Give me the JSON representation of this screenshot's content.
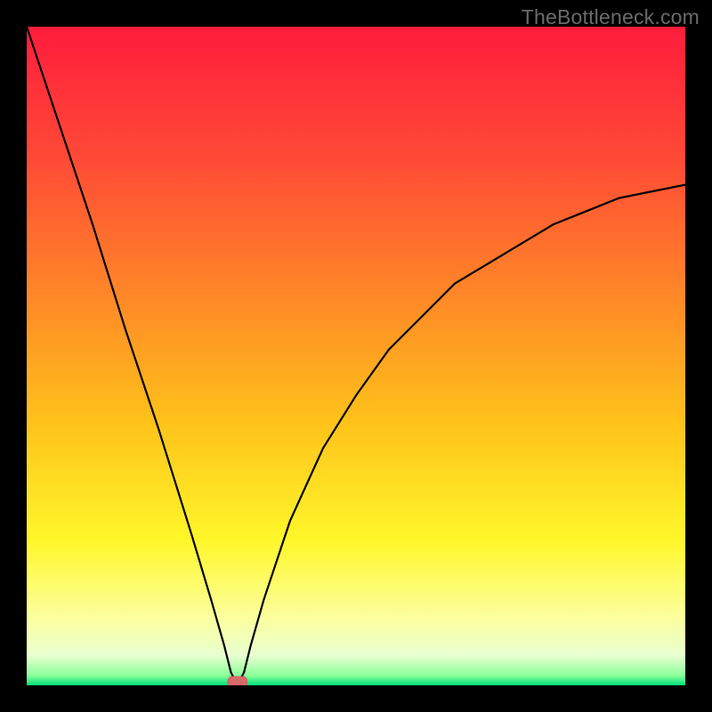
{
  "attribution": "TheBottleneck.com",
  "chart_data": {
    "type": "line",
    "title": "",
    "xlabel": "",
    "ylabel": "",
    "xlim": [
      0,
      100
    ],
    "ylim": [
      0,
      100
    ],
    "grid": false,
    "legend": false,
    "series": [
      {
        "name": "bottleneck-curve",
        "x": [
          0,
          5,
          10,
          15,
          20,
          25,
          28,
          30,
          31,
          32,
          33,
          34,
          36,
          38,
          40,
          45,
          50,
          55,
          60,
          65,
          70,
          75,
          80,
          85,
          90,
          95,
          100
        ],
        "y": [
          100,
          85,
          70,
          54,
          39,
          23,
          13,
          6,
          2,
          0,
          2,
          6,
          13,
          19,
          25,
          36,
          44,
          51,
          56,
          61,
          64,
          67,
          70,
          72,
          74,
          75,
          76
        ]
      }
    ],
    "marker": {
      "name": "optimum-point",
      "x": 32,
      "y": 0,
      "color": "#d96a6a"
    },
    "background_gradient": {
      "type": "vertical",
      "stops": [
        {
          "pos": 0.0,
          "color": "#ff1c3c"
        },
        {
          "pos": 0.2,
          "color": "#ff4a36"
        },
        {
          "pos": 0.4,
          "color": "#ff8528"
        },
        {
          "pos": 0.6,
          "color": "#ffc21a"
        },
        {
          "pos": 0.78,
          "color": "#fff72a"
        },
        {
          "pos": 0.9,
          "color": "#fbffa0"
        },
        {
          "pos": 0.955,
          "color": "#e8ffd0"
        },
        {
          "pos": 0.985,
          "color": "#8cff9a"
        },
        {
          "pos": 1.0,
          "color": "#00e07a"
        }
      ]
    }
  }
}
